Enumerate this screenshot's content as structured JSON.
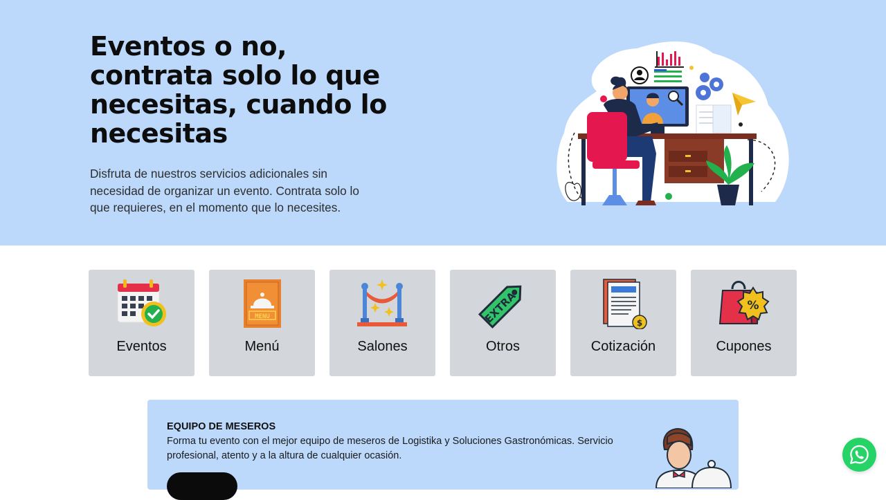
{
  "hero": {
    "title": "Eventos o no, contrata solo lo que necesitas, cuando lo necesitas",
    "subtitle": "Disfruta de nuestros servicios adicionales sin necesidad de organizar un evento. Contrata solo lo que requieres, en el momento que lo necesites.",
    "background": "#bcd9fb"
  },
  "categories": [
    {
      "label": "Eventos",
      "icon": "calendar-check-icon"
    },
    {
      "label": "Menú",
      "icon": "menu-book-icon"
    },
    {
      "label": "Salones",
      "icon": "venue-rope-icon"
    },
    {
      "label": "Otros",
      "icon": "extra-tag-icon"
    },
    {
      "label": "Cotización",
      "icon": "quote-document-icon"
    },
    {
      "label": "Cupones",
      "icon": "coupon-bag-icon"
    }
  ],
  "service_panel": {
    "title": "EQUIPO DE MESEROS",
    "description": "Forma tu evento con el mejor equipo de meseros de Logistika y Soluciones Gastronómicas. Servicio profesional, atento y a la altura de cualquier ocasión."
  },
  "colors": {
    "card_background": "#d3d6db",
    "whatsapp": "#25d366",
    "button": "#0b0b0b"
  }
}
